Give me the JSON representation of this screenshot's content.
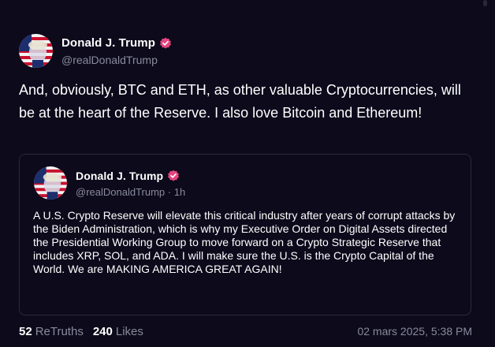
{
  "post": {
    "author": {
      "name": "Donald J. Trump",
      "handle": "@realDonaldTrump",
      "verified_icon": "verified-badge-icon"
    },
    "text": "And, obviously, BTC and ETH, as other valuable Cryptocurrencies, will be at the heart of the Reserve. I also love Bitcoin and Ethereum!",
    "quoted_post": {
      "author": {
        "name": "Donald J. Trump",
        "handle": "@realDonaldTrump",
        "age": "1h"
      },
      "text": "A U.S. Crypto Reserve will elevate this critical industry after years of corrupt attacks by the Biden Administration, which is why my Executive Order on Digital Assets directed the Presidential Working Group to move forward on a Crypto Strategic Reserve that includes XRP, SOL, and ADA. I will make sure the U.S. is the Crypto Capital of the World. We are MAKING AMERICA GREAT AGAIN!"
    },
    "stats": {
      "retruths_count": "52",
      "retruths_label": "ReTruths",
      "likes_count": "240",
      "likes_label": "Likes"
    },
    "timestamp": "02 mars 2025, 5:38 PM"
  },
  "colors": {
    "background": "#0c0a1b",
    "verified_badge": "#e5447f",
    "muted_text": "#8a8a9e",
    "border": "#2b2940"
  }
}
